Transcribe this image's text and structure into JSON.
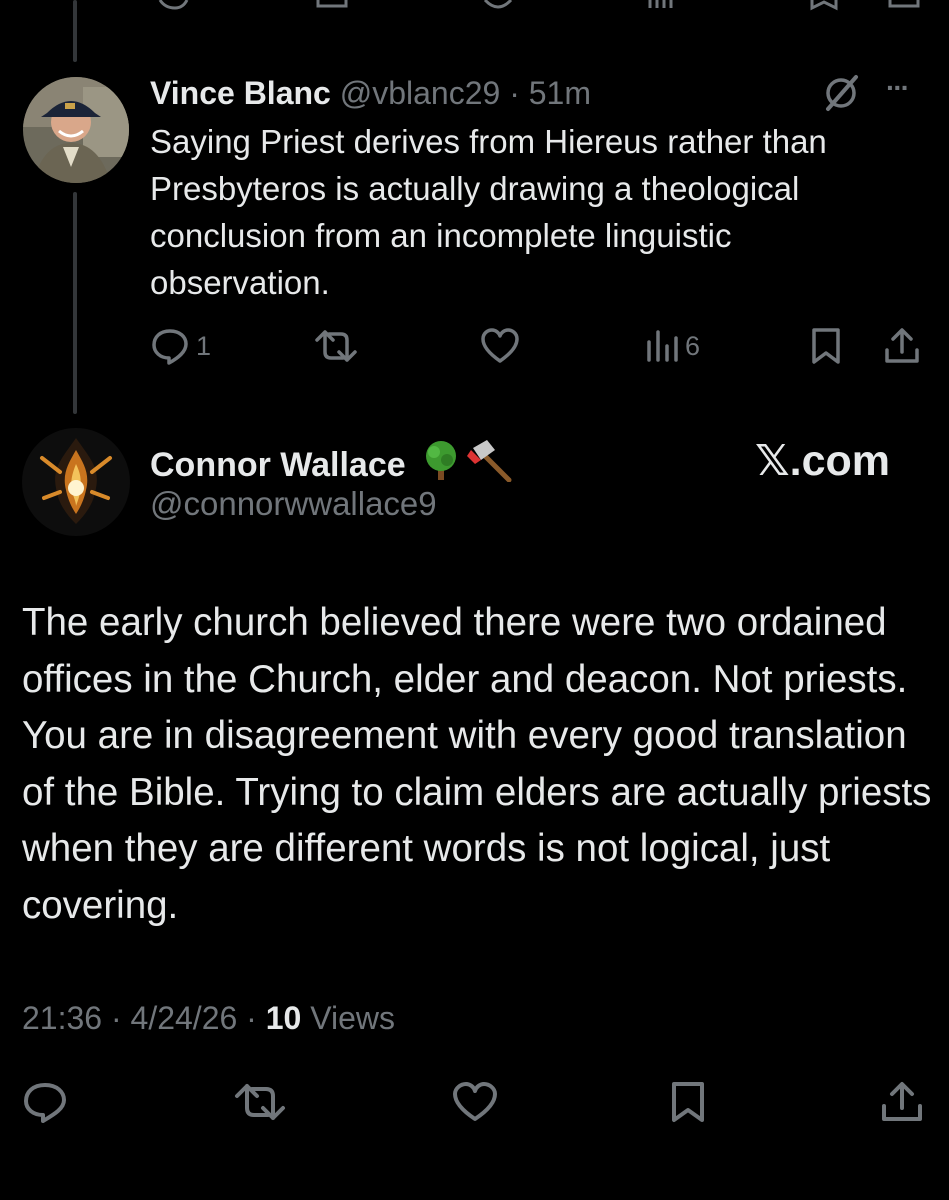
{
  "reply": {
    "author_name": "Vince Blanc",
    "handle": "@vblanc29",
    "separator": "·",
    "time_ago": "51m",
    "more_label": "···",
    "text": "Saying Priest derives from Hiereus rather than Presbyteros is actually drawing a theological conclusion from an incomplete linguistic observation.",
    "stats": {
      "replies": "1",
      "views": "6"
    }
  },
  "main": {
    "author_name": "Connor Wallace",
    "author_emojis": "🌳🪓",
    "handle": "@connorwwallace9",
    "watermark": "𝕏.com",
    "text": "The early church believed there were two ordained offices in the Church, elder and deacon. Not priests. You are in disagreement with every good translation of the Bible. Trying to claim elders are actually priests when they are different words is not logical, just covering.",
    "time": "21:36",
    "date": "4/24/26",
    "separator": "·",
    "views_count": "10",
    "views_label": "Views"
  },
  "colors": {
    "background": "#000000",
    "text": "#e7e9ea",
    "muted": "#71767b",
    "thread_line": "#333639"
  },
  "icons": {
    "reply": "speech-bubble-icon",
    "repost": "repost-arrows-icon",
    "like": "heart-icon",
    "views": "bar-chart-icon",
    "bookmark": "bookmark-icon",
    "share": "share-upload-icon",
    "grok": "grok-slash-icon"
  }
}
